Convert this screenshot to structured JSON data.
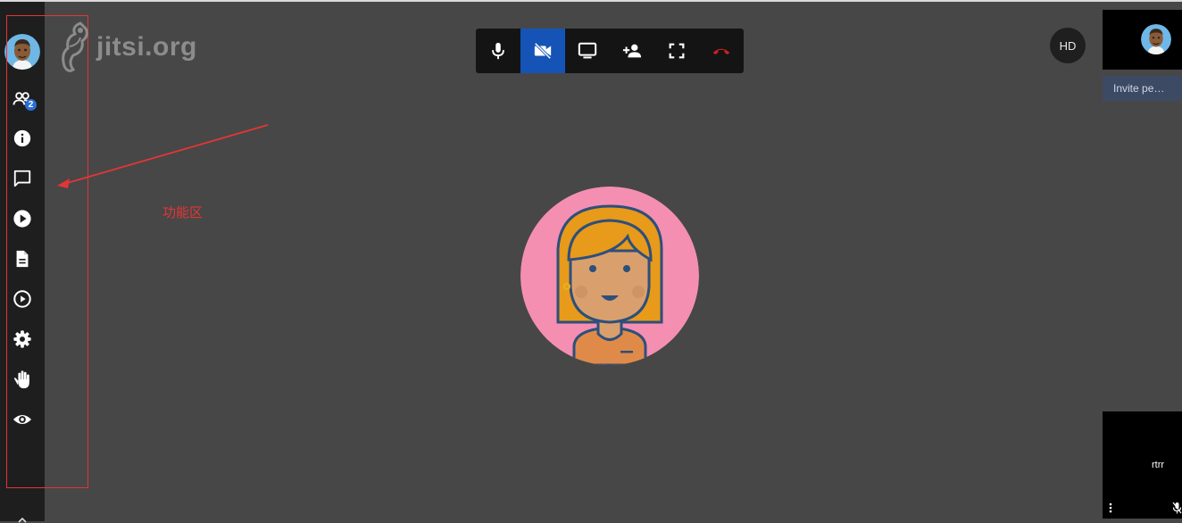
{
  "logo": {
    "text": "jitsi.org",
    "icon": "jitsi-logo-icon"
  },
  "sidebar": {
    "items": [
      {
        "name": "participants",
        "icon": "participants-icon",
        "badge": "2"
      },
      {
        "name": "info",
        "icon": "info-icon"
      },
      {
        "name": "chat",
        "icon": "chat-icon"
      },
      {
        "name": "share-video",
        "icon": "play-circle-icon"
      },
      {
        "name": "shared-document",
        "icon": "document-icon"
      },
      {
        "name": "recording",
        "icon": "play-outline-icon"
      },
      {
        "name": "settings",
        "icon": "gear-icon"
      },
      {
        "name": "raise-hand",
        "icon": "hand-icon"
      },
      {
        "name": "watch",
        "icon": "eye-icon"
      }
    ]
  },
  "annotation": {
    "label": "功能区",
    "color": "#e53535"
  },
  "toolbar": {
    "buttons": [
      {
        "name": "microphone",
        "icon": "microphone-icon",
        "active": false
      },
      {
        "name": "camera",
        "icon": "camera-off-icon",
        "active": true
      },
      {
        "name": "screen-share",
        "icon": "monitor-icon",
        "active": false
      },
      {
        "name": "invite",
        "icon": "add-person-icon",
        "active": false
      },
      {
        "name": "fullscreen",
        "icon": "fullscreen-icon",
        "active": false
      },
      {
        "name": "hangup",
        "icon": "hangup-icon",
        "active": false
      }
    ]
  },
  "video_quality": {
    "label": "HD"
  },
  "filmstrip": {
    "invite_label": "Invite pe…",
    "remote_name": "rtrr"
  },
  "colors": {
    "background": "#474747",
    "sidebar": "#1e1e1e",
    "toolbar": "#141414",
    "active": "#1554b6",
    "hangup": "#d21f1f",
    "avatar_bg": "#f48fb1",
    "accent": "#2b6fd6"
  }
}
